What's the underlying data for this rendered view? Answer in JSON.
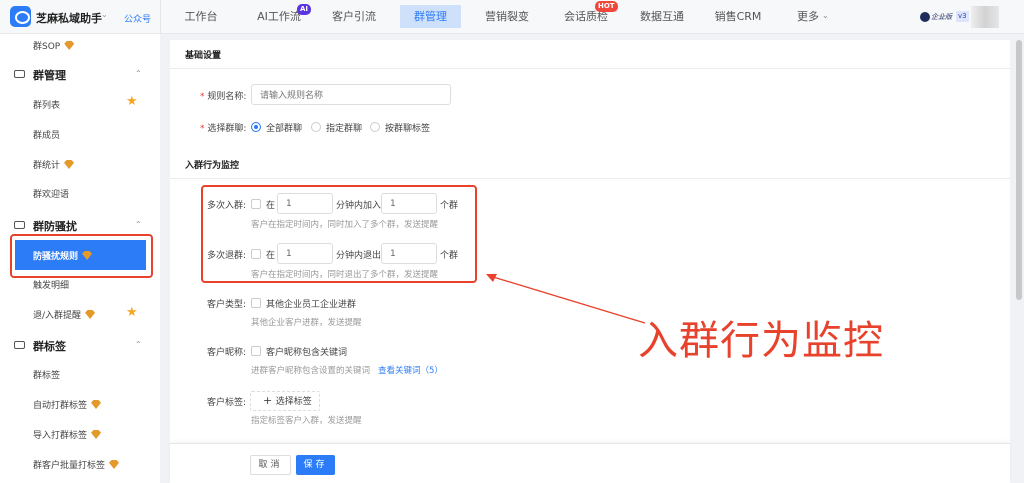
{
  "app": {
    "name": "芝麻私域助手",
    "account_link": "公众号",
    "edition": "企业版",
    "version": "v3"
  },
  "nav": [
    {
      "label": "工作台"
    },
    {
      "label": "AI工作流",
      "badge": "AI"
    },
    {
      "label": "客户引流"
    },
    {
      "label": "群管理",
      "active": true
    },
    {
      "label": "营销裂变"
    },
    {
      "label": "会话质检",
      "badge": "HOT"
    },
    {
      "label": "数据互通"
    },
    {
      "label": "销售CRM"
    },
    {
      "label": "更多"
    }
  ],
  "sidebar": {
    "items": [
      "群SOP",
      "群列表",
      "群成员",
      "群统计",
      "群欢迎语",
      "防骚扰规则",
      "触发明细",
      "退/入群提醒",
      "群标签",
      "自动打群标签",
      "导入打群标签",
      "群客户批量打标签"
    ],
    "groups": [
      "群管理",
      "群防骚扰",
      "群标签"
    ],
    "active": "防骚扰规则"
  },
  "form": {
    "section_basic": "基础设置",
    "rule_name_label": "规则名称:",
    "rule_name_placeholder": "请输入规则名称",
    "select_group_label": "选择群聊:",
    "radio_options": [
      "全部群聊",
      "指定群聊",
      "按群聊标签"
    ],
    "radio_selected": "全部群聊",
    "section_monitor": "入群行为监控",
    "multi_join": {
      "label": "多次入群:",
      "in": "在",
      "minutes": "1",
      "mid": "分钟内加入",
      "count": "1",
      "unit": "个群",
      "help": "客户在指定时间内，同时加入了多个群，发送提醒"
    },
    "multi_leave": {
      "label": "多次退群:",
      "in": "在",
      "minutes": "1",
      "mid": "分钟内退出",
      "count": "1",
      "unit": "个群",
      "help": "客户在指定时间内，同时退出了多个群，发送提醒"
    },
    "customer_type": {
      "label": "客户类型:",
      "option": "其他企业员工企业进群",
      "help": "其他企业客户进群，发送提醒"
    },
    "customer_nick": {
      "label": "客户昵称:",
      "option": "客户昵称包含关键词",
      "help": "进群客户昵称包含设置的关键词",
      "link": "查看关键词（5）"
    },
    "customer_tag": {
      "label": "客户标签:",
      "button": "选择标签",
      "help": "指定标签客户入群，发送提醒"
    },
    "cancel": "取消",
    "save": "保存"
  },
  "annotation": {
    "text": "入群行为监控",
    "color": "#e8412c"
  },
  "colors": {
    "primary": "#2b7cf6",
    "highlight": "#e8412c"
  }
}
